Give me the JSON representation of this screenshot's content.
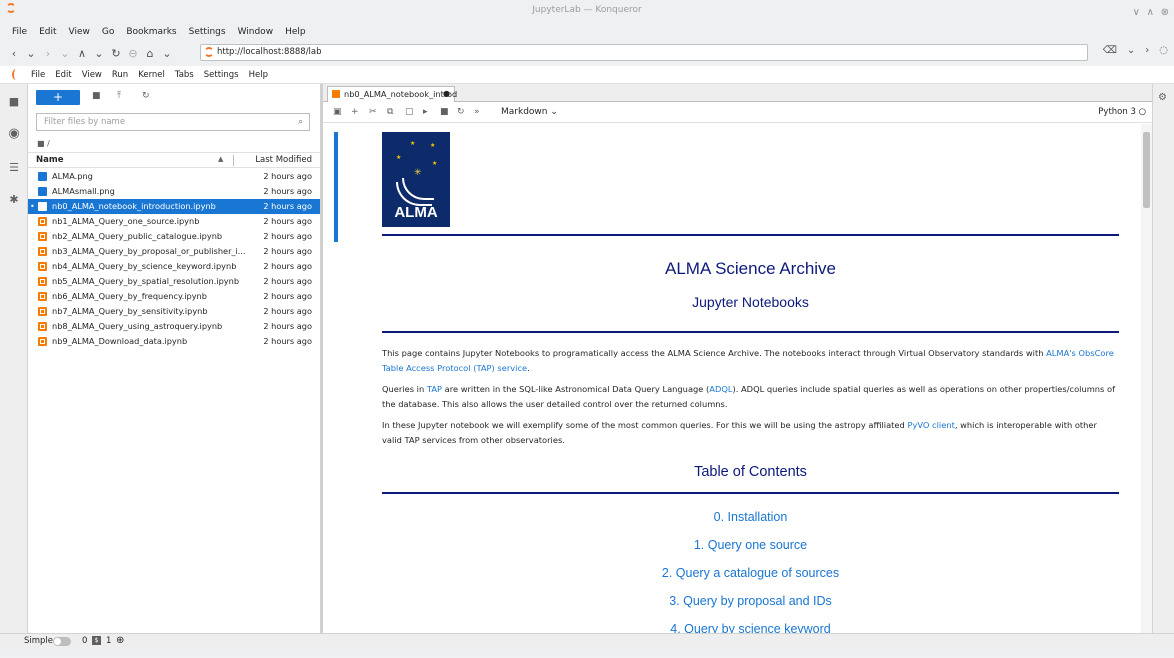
{
  "window": {
    "title": "JupyterLab — Konqueror"
  },
  "browser_menu": [
    "File",
    "Edit",
    "View",
    "Go",
    "Bookmarks",
    "Settings",
    "Window",
    "Help"
  ],
  "url": "http://localhost:8888/lab",
  "jl_menu": [
    "File",
    "Edit",
    "View",
    "Run",
    "Kernel",
    "Tabs",
    "Settings",
    "Help"
  ],
  "filebrowser": {
    "new_label": "+",
    "filter_placeholder": "Filter files by name",
    "breadcrumb": "/",
    "col_name": "Name",
    "col_modified": "Last Modified",
    "files": [
      {
        "name": "ALMA.png",
        "modified": "2 hours ago",
        "type": "img"
      },
      {
        "name": "ALMAsmall.png",
        "modified": "2 hours ago",
        "type": "img"
      },
      {
        "name": "nb0_ALMA_notebook_introduction.ipynb",
        "modified": "2 hours ago",
        "type": "nb",
        "selected": true
      },
      {
        "name": "nb1_ALMA_Query_one_source.ipynb",
        "modified": "2 hours ago",
        "type": "nb"
      },
      {
        "name": "nb2_ALMA_Query_public_catalogue.ipynb",
        "modified": "2 hours ago",
        "type": "nb"
      },
      {
        "name": "nb3_ALMA_Query_by_proposal_or_publisher_i...",
        "modified": "2 hours ago",
        "type": "nb"
      },
      {
        "name": "nb4_ALMA_Query_by_science_keyword.ipynb",
        "modified": "2 hours ago",
        "type": "nb"
      },
      {
        "name": "nb5_ALMA_Query_by_spatial_resolution.ipynb",
        "modified": "2 hours ago",
        "type": "nb"
      },
      {
        "name": "nb6_ALMA_Query_by_frequency.ipynb",
        "modified": "2 hours ago",
        "type": "nb"
      },
      {
        "name": "nb7_ALMA_Query_by_sensitivity.ipynb",
        "modified": "2 hours ago",
        "type": "nb"
      },
      {
        "name": "nb8_ALMA_Query_using_astroquery.ipynb",
        "modified": "2 hours ago",
        "type": "nb"
      },
      {
        "name": "nb9_ALMA_Download_data.ipynb",
        "modified": "2 hours ago",
        "type": "nb"
      }
    ]
  },
  "notebook": {
    "tab_label": "nb0_ALMA_notebook_introd",
    "cell_type": "Markdown",
    "kernel": "Python 3",
    "logo_text": "ALMA",
    "title": "ALMA Science Archive",
    "subtitle": "Jupyter Notebooks",
    "p1_a": "This page contains Jupyter Notebooks to programatically access the ALMA Science Archive. The notebooks interact through Virtual Observatory standards with ",
    "p1_link": "ALMA's ObsCore Table Access Protocol (TAP) service",
    "p1_b": ".",
    "p2_a": "Queries in ",
    "p2_link1": "TAP",
    "p2_b": " are written in the SQL-like Astronomical Data Query Language (",
    "p2_link2": "ADQL",
    "p2_c": "). ADQL queries include spatial queries as well as operations on other properties/columns of the database. This also allows the user detailed control over the returned columns.",
    "p3_a": "In these Jupyter notebook we will exemplify some of the most common queries. For this we will be using the astropy affiliated ",
    "p3_link": "PyVO client",
    "p3_b": ", which is interoperable with other valid TAP services from other observatories.",
    "toc_title": "Table of Contents",
    "toc": [
      "0. Installation",
      "1. Query one source",
      "2. Query a catalogue of sources",
      "3. Query by proposal and IDs",
      "4. Query by science keyword"
    ]
  },
  "status": {
    "mode": "Simple",
    "terminals": "0",
    "kernels": "1"
  }
}
